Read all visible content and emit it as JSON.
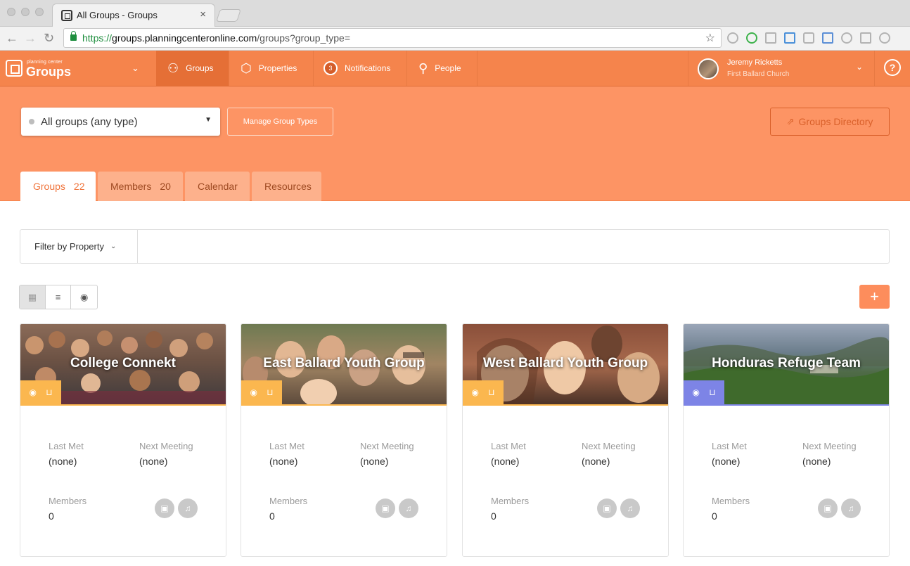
{
  "browser": {
    "tab_title": "All Groups - Groups",
    "tab_close": "×",
    "url_protocol": "https://",
    "url_host": "groups.planningcenteronline.com",
    "url_path": "/groups?group_type=",
    "back": "←",
    "forward": "→",
    "reload": "↻",
    "star": "☆"
  },
  "app": {
    "logo_small": "planning center",
    "logo_big": "Groups",
    "app_switch_chevron": "⌄",
    "nav": [
      {
        "label": "Groups",
        "icon": "⚇"
      },
      {
        "label": "Properties",
        "icon": "⬡"
      },
      {
        "label": "Notifications",
        "badge": "3"
      },
      {
        "label": "People",
        "icon": "⚲"
      }
    ],
    "user": {
      "name": "Jeremy Ricketts",
      "org": "First Ballard Church",
      "chevron": "⌄"
    },
    "help": "?"
  },
  "subheader": {
    "group_type_select": "All groups (any type)",
    "select_caret": "▼",
    "manage_label": "Manage Group Types",
    "directory_label": "Groups Directory",
    "directory_icon": "⇗",
    "tabs": [
      {
        "label": "Groups",
        "count": "22"
      },
      {
        "label": "Members",
        "count": "20"
      },
      {
        "label": "Calendar"
      },
      {
        "label": "Resources"
      }
    ]
  },
  "filter": {
    "button_label": "Filter by Property",
    "chevron": "⌄",
    "input_placeholder": ""
  },
  "views": {
    "grid_icon": "▦",
    "list_icon": "≡",
    "map_icon": "◉"
  },
  "add_label": "+",
  "card_labels": {
    "last_met": "Last Met",
    "next_meeting": "Next Meeting",
    "members": "Members"
  },
  "icons": {
    "eye": "◉",
    "lock": "⊔",
    "note": "▣",
    "bell": "♫"
  },
  "colors": {
    "brand": "#f5844c",
    "subheader": "#fd9464",
    "badge_orange": "#fbb74f",
    "badge_blue": "#7d84e6"
  },
  "groups": [
    {
      "name": "College Connekt",
      "last_met": "(none)",
      "next_meeting": "(none)",
      "members": "0"
    },
    {
      "name": "East Ballard Youth Group",
      "last_met": "(none)",
      "next_meeting": "(none)",
      "members": "0"
    },
    {
      "name": "West Ballard Youth Group",
      "last_met": "(none)",
      "next_meeting": "(none)",
      "members": "0"
    },
    {
      "name": "Honduras Refuge Team",
      "last_met": "(none)",
      "next_meeting": "(none)",
      "members": "0"
    }
  ]
}
